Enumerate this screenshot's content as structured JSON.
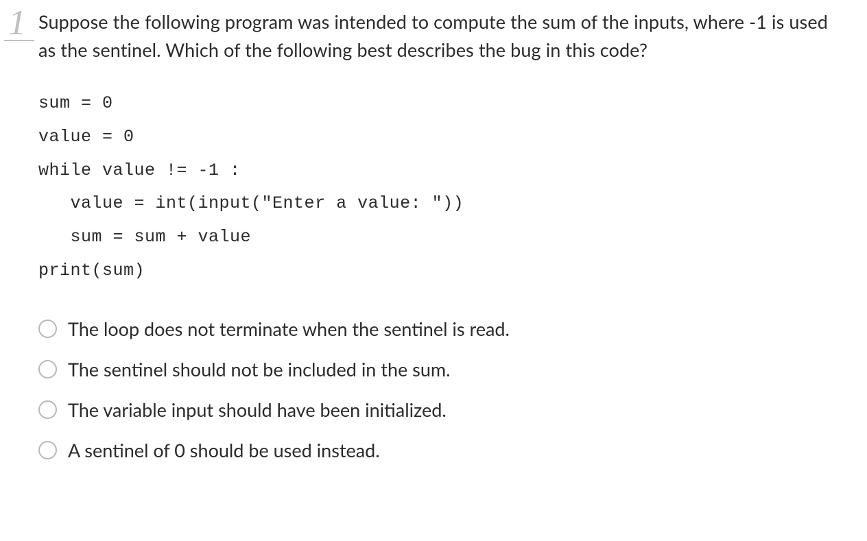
{
  "question": {
    "number_glyph": "1",
    "prompt": "Suppose the following program was intended to compute the sum of the inputs, where -1 is used as the sentinel.  Which of the following best describes the bug in this code?",
    "code": "sum = 0\nvalue = 0\nwhile value != -1 :\n   value = int(input(\"Enter a value: \"))\n   sum = sum + value\nprint(sum)",
    "options": [
      "The loop does not terminate when the sentinel is read.",
      "The sentinel should not be included in the sum.",
      "The variable input should have been initialized.",
      "A sentinel of 0 should be used instead."
    ]
  }
}
